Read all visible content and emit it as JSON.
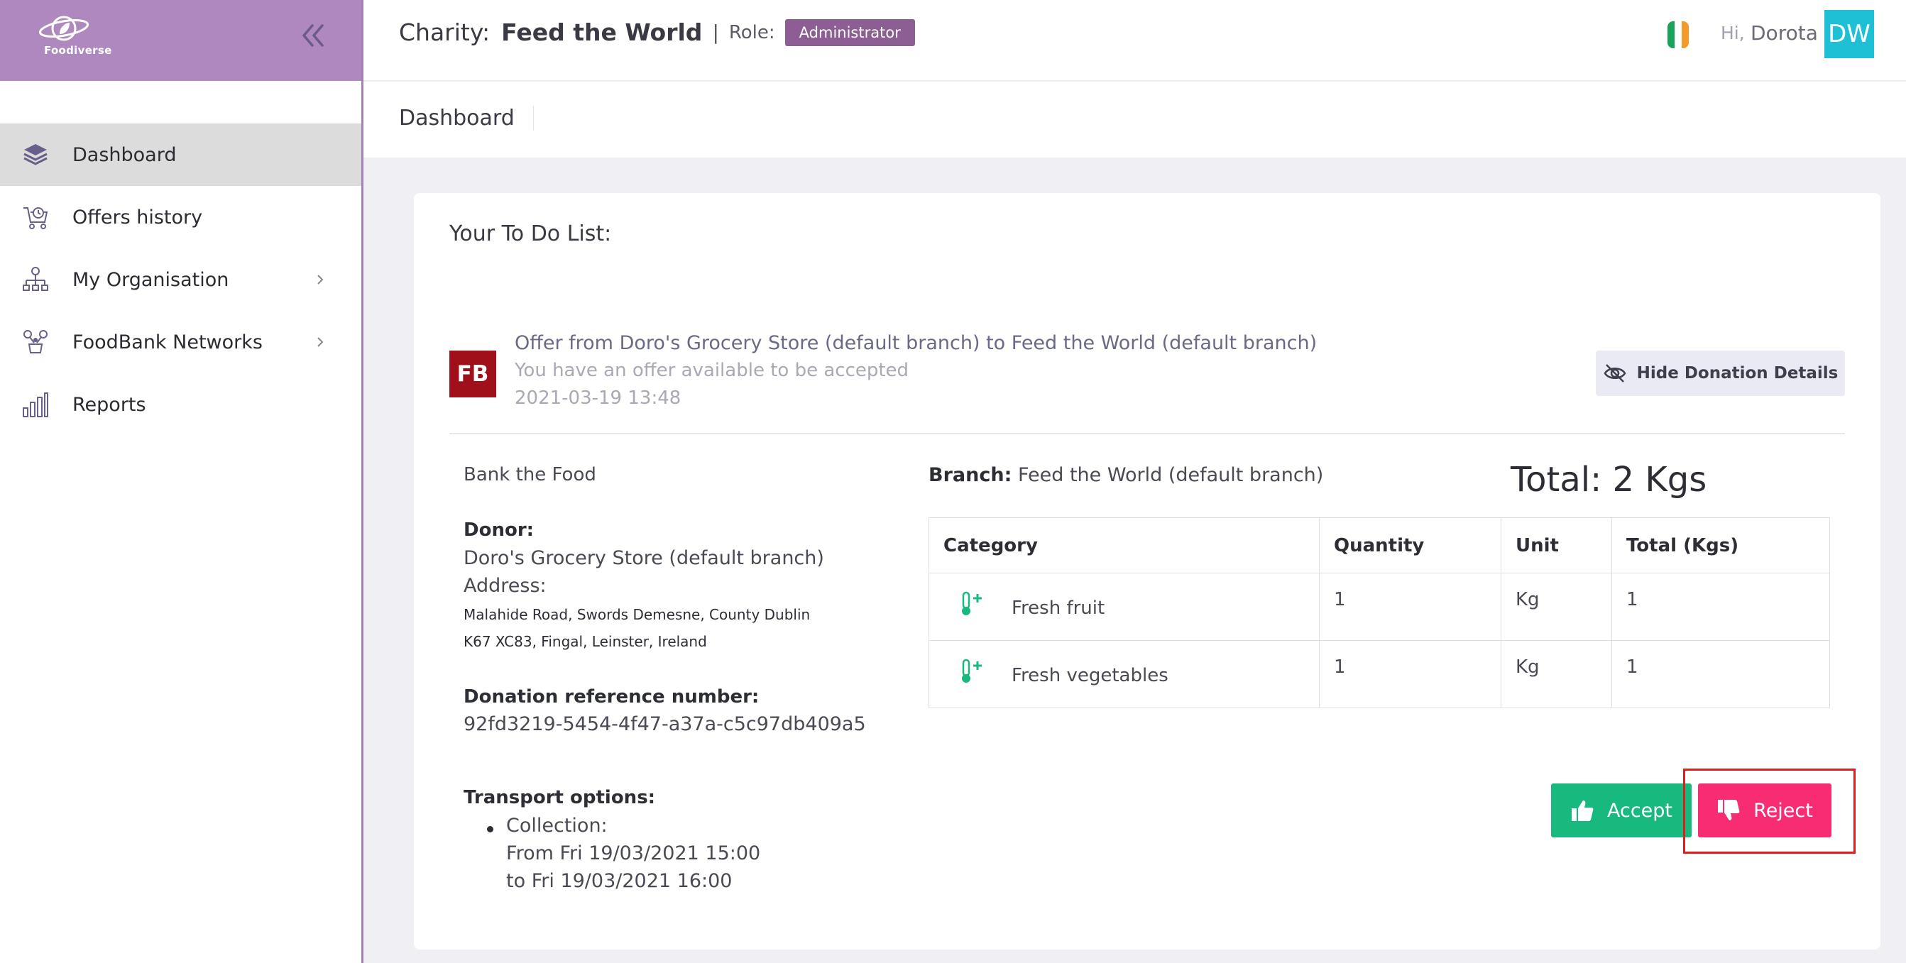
{
  "brand": {
    "logo_text": "Foodiverse",
    "color": "#ae88be"
  },
  "sidebar": {
    "items": [
      {
        "label": "Dashboard",
        "icon": "layers-icon",
        "active": true
      },
      {
        "label": "Offers history",
        "icon": "cart-history-icon"
      },
      {
        "label": "My Organisation",
        "icon": "org-chart-icon",
        "expandable": true
      },
      {
        "label": "FoodBank Networks",
        "icon": "network-icon",
        "expandable": true
      },
      {
        "label": "Reports",
        "icon": "bar-chart-icon"
      }
    ]
  },
  "header": {
    "charity_prefix": "Charity:",
    "charity_name": "Feed the World",
    "separator": "|",
    "role_label": "Role:",
    "role_value": "Administrator",
    "greeting": "Hi,",
    "user_name": "Dorota",
    "avatar_initials": "DW"
  },
  "page": {
    "title": "Dashboard"
  },
  "todo": {
    "title": "Your To Do List:",
    "offer": {
      "avatar_initials": "FB",
      "title": "Offer from Doro's Grocery Store (default branch) to Feed the World (default branch)",
      "subtitle": "You have an offer available to be accepted",
      "date": "2021-03-19 13:48",
      "hide_details_label": "Hide Donation Details"
    }
  },
  "donation": {
    "bank_name": "Bank the Food",
    "donor_label": "Donor:",
    "donor_name": "Doro's Grocery Store (default branch)",
    "address_label": "Address:",
    "address_line1": "Malahide Road, Swords Demesne, County Dublin",
    "address_line2": "K67 XC83, Fingal, Leinster, Ireland",
    "ref_label": "Donation reference number:",
    "ref_value": "92fd3219-5454-4f47-a37a-c5c97db409a5",
    "transport_label": "Transport options:",
    "transport_type": "Collection:",
    "transport_from": "From Fri 19/03/2021 15:00",
    "transport_to": "to Fri 19/03/2021 16:00",
    "branch_label": "Branch:",
    "branch_value": "Feed the World (default branch)",
    "total": "Total: 2 Kgs"
  },
  "table": {
    "headers": [
      "Category",
      "Quantity",
      "Unit",
      "Total (Kgs)"
    ],
    "rows": [
      {
        "category": "Fresh fruit",
        "quantity": "1",
        "unit": "Kg",
        "total": "1"
      },
      {
        "category": "Fresh vegetables",
        "quantity": "1",
        "unit": "Kg",
        "total": "1"
      }
    ]
  },
  "actions": {
    "accept_label": "Accept",
    "reject_label": "Reject"
  },
  "colors": {
    "accept": "#18b97e",
    "reject": "#f72c73",
    "role_badge": "#8c5e94",
    "avatar": "#1ec0d6",
    "highlight": "#e01c1c"
  }
}
